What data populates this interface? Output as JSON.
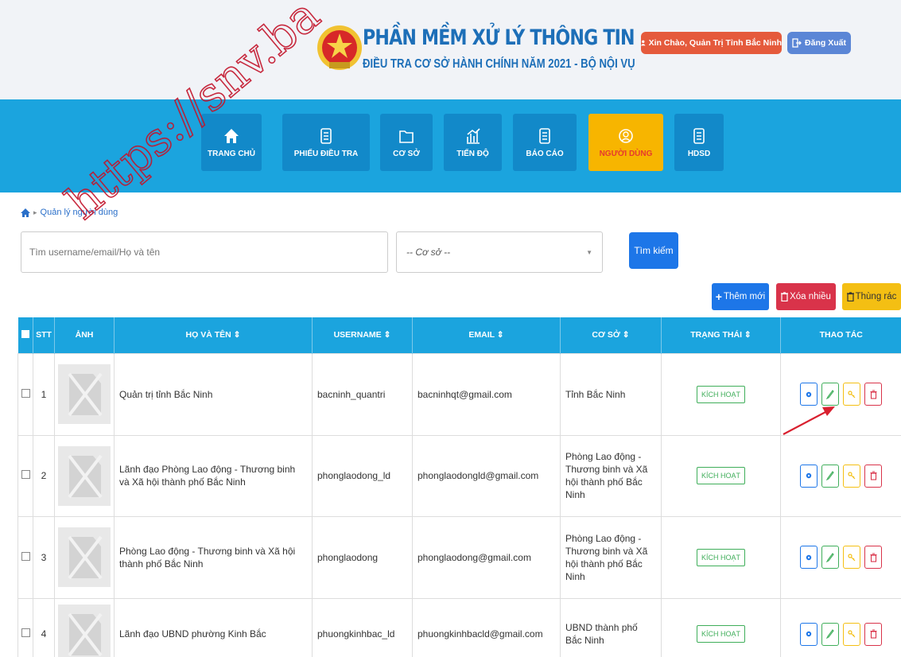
{
  "header": {
    "title": "PHẦN MỀM XỬ LÝ THÔNG TIN",
    "subtitle": "ĐIỀU TRA CƠ SỞ HÀNH CHÍNH NĂM 2021 - BỘ NỘI VỤ",
    "greeting": "Xin Chào, Quản Trị Tỉnh Bắc Ninh",
    "logout": "Đăng Xuất"
  },
  "nav": {
    "items": [
      {
        "label": "TRANG CHỦ",
        "icon": "home-icon"
      },
      {
        "label": "PHIẾU ĐIỀU TRA",
        "icon": "document-icon"
      },
      {
        "label": "CƠ SỞ",
        "icon": "folder-icon"
      },
      {
        "label": "TIẾN ĐỘ",
        "icon": "chart-icon"
      },
      {
        "label": "BÁO CÁO",
        "icon": "document-icon"
      },
      {
        "label": "NGƯỜI DÙNG",
        "icon": "user-icon"
      },
      {
        "label": "HDSD",
        "icon": "document-icon"
      }
    ],
    "active": "NGƯỜI DÙNG"
  },
  "breadcrumb": {
    "current": "Quản lý người dùng"
  },
  "search": {
    "placeholder": "Tìm username/email/Họ và tên",
    "select_value": "-- Cơ sở --",
    "button": "Tìm kiếm"
  },
  "toolbar": {
    "add": "Thêm mới",
    "delete_many": "Xóa nhiều",
    "trash": "Thùng rác"
  },
  "table": {
    "headers": {
      "stt": "STT",
      "avatar": "ẢNH",
      "name": "HỌ VÀ TÊN ⇕",
      "username": "USERNAME ⇕",
      "email": "EMAIL ⇕",
      "unit": "CƠ SỞ ⇕",
      "status": "TRẠNG THÁI ⇕",
      "actions": "THAO TÁC"
    },
    "rows": [
      {
        "stt": "1",
        "name": "Quản trị tỉnh Bắc Ninh",
        "username": "bacninh_quantri",
        "email": "bacninhqt@gmail.com",
        "unit": "Tỉnh Bắc Ninh",
        "status": "KÍCH HOẠT"
      },
      {
        "stt": "2",
        "name": "Lãnh đạo Phòng Lao động - Thương binh và Xã hội thành phố Bắc Ninh",
        "username": "phonglaodong_ld",
        "email": "phonglaodongld@gmail.com",
        "unit": "Phòng Lao động - Thương binh và Xã hội thành phố Bắc Ninh",
        "status": "KÍCH HOẠT"
      },
      {
        "stt": "3",
        "name": "Phòng Lao động - Thương binh và Xã hội thành phố Bắc Ninh",
        "username": "phonglaodong",
        "email": "phonglaodong@gmail.com",
        "unit": "Phòng Lao động - Thương binh và Xã hội thành phố Bắc Ninh",
        "status": "KÍCH HOẠT"
      },
      {
        "stt": "4",
        "name": "Lãnh đạo UBND phường Kinh Bắc",
        "username": "phuongkinhbac_ld",
        "email": "phuongkinhbacld@gmail.com",
        "unit": "UBND thành phố Bắc Ninh",
        "status": "KÍCH HOẠT"
      }
    ]
  },
  "watermark": "https://snv.ba",
  "colors": {
    "primary": "#1ba4de",
    "nav_button": "#1289c9",
    "active": "#f7b500",
    "title": "#1d6fb8",
    "danger": "#d9334a",
    "success": "#3fae5a"
  }
}
